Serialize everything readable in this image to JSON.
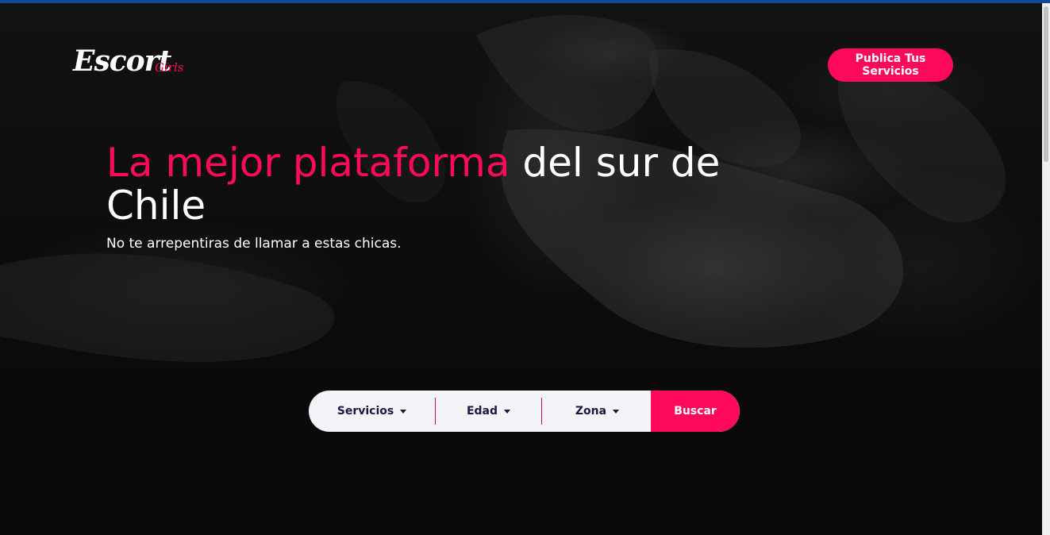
{
  "brand": {
    "logo_main": "Escort",
    "logo_sub": "Girls",
    "accent_color": "#ff0a5a"
  },
  "header": {
    "publish_button_label": "Publica Tus Servicios"
  },
  "hero": {
    "headline_accent": "La mejor plataforma",
    "headline_rest": " del sur de Chile",
    "subheadline": "No te arrepentiras de llamar a estas chicas."
  },
  "search": {
    "filters": [
      {
        "label": "Servicios",
        "icon": "chevron-down-icon"
      },
      {
        "label": "Edad",
        "icon": "chevron-down-icon"
      },
      {
        "label": "Zona",
        "icon": "chevron-down-icon"
      }
    ],
    "submit_label": "Buscar"
  }
}
